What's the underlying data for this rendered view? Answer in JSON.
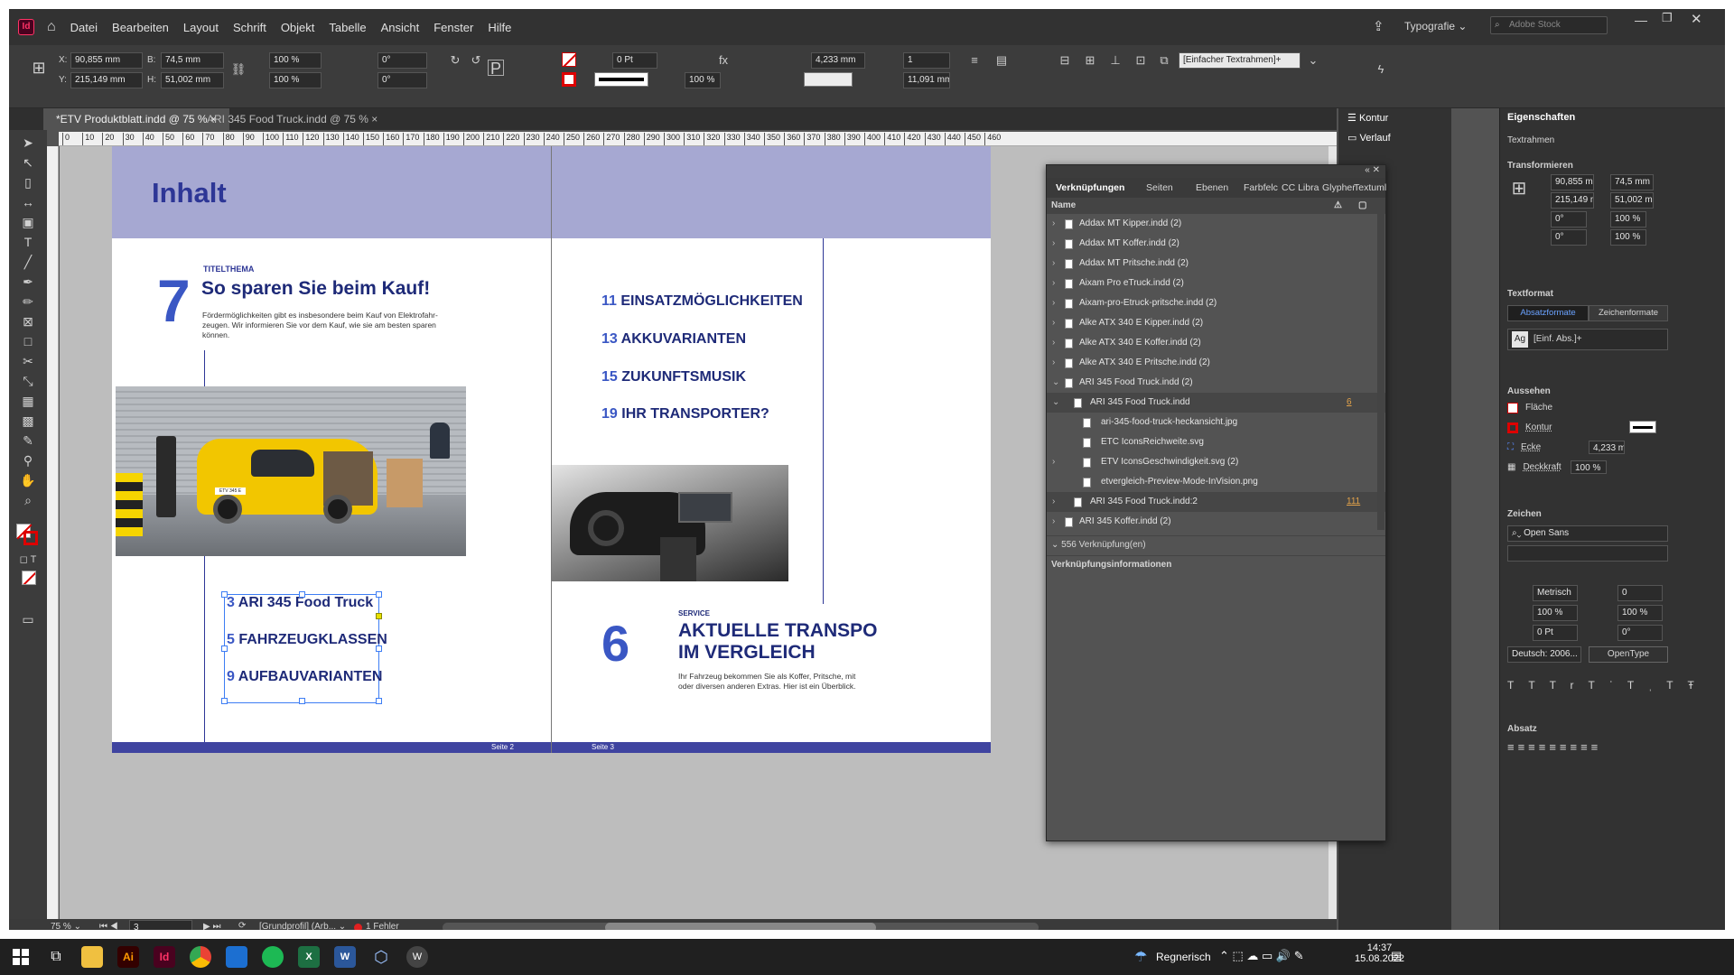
{
  "menu": {
    "items": [
      "Datei",
      "Bearbeiten",
      "Layout",
      "Schrift",
      "Objekt",
      "Tabelle",
      "Ansicht",
      "Fenster",
      "Hilfe"
    ],
    "workspace": "Typografie",
    "search_placeholder": "Adobe Stock",
    "app_badge": "Id"
  },
  "control": {
    "x": "90,855 mm",
    "y": "215,149 mm",
    "w": "74,5 mm",
    "h": "51,002 mm",
    "scale_x": "100 %",
    "scale_y": "100 %",
    "angle": "0°",
    "shear": "0°",
    "stroke": "0 Pt",
    "opacity": "100 %",
    "corner": "4,233 mm",
    "columns": "1",
    "gutter": "11,091 mm",
    "frame_style": "[Einfacher Textrahmen]+",
    "x_label": "X:",
    "y_label": "Y:",
    "b_label": "B:",
    "h_label": "H:"
  },
  "tabs": [
    {
      "label": "*ETV Produktblatt.indd @ 75 %"
    },
    {
      "label": "ARI 345 Food Truck.indd @ 75 %"
    }
  ],
  "ruler": {
    "ticks": [
      "0",
      "10",
      "20",
      "30",
      "40",
      "50",
      "60",
      "70",
      "80",
      "90",
      "100",
      "110",
      "120",
      "130",
      "140",
      "150",
      "160",
      "170",
      "180",
      "190",
      "200",
      "210",
      "220",
      "230",
      "240",
      "250",
      "260",
      "270",
      "280",
      "290",
      "300",
      "310",
      "320",
      "330",
      "340",
      "350",
      "360",
      "370",
      "380",
      "390",
      "400",
      "410",
      "420",
      "430",
      "440",
      "450",
      "460"
    ]
  },
  "page_left": {
    "header": "Inhalt",
    "kicker": "TITELTHEMA",
    "big_num": "7",
    "headline": "So sparen Sie beim Kauf!",
    "body": "Fördermöglichkeiten gibt es insbesondere beim Kauf von Elektrofahr-zeugen. Wir informieren Sie vor dem Kauf, wie sie am besten sparen können.",
    "toc": [
      {
        "num": "3",
        "text": "ARI 345 Food Truck"
      },
      {
        "num": "5",
        "text": "FAHRZEUGKLASSEN"
      },
      {
        "num": "9",
        "text": "AUFBAUVARIANTEN"
      }
    ],
    "footer": "Seite 2"
  },
  "page_right": {
    "toc": [
      {
        "num": "11",
        "text": "EINSATZMÖGLICHKEITEN"
      },
      {
        "num": "13",
        "text": "AKKUVARIANTEN"
      },
      {
        "num": "15",
        "text": "ZUKUNFTSMUSIK"
      },
      {
        "num": "19",
        "text": "IHR TRANSPORTER?"
      }
    ],
    "kicker": "SERVICE",
    "big_num": "6",
    "headline1": "AKTUELLE TRANSPO",
    "headline2": "IM VERGLEICH",
    "body1": "Ihr Fahrzeug bekommen Sie als  Koffer, Pritsche, mit",
    "body2": "oder diversen anderen Extras. Hier ist ein Überblick.",
    "footer": "Seite 3",
    "plate": "ETV 345 E"
  },
  "status": {
    "zoom": "75 %",
    "page": "3",
    "profile": "[Grundprofil] (Arb...",
    "errors": "1 Fehler"
  },
  "mini_panels": [
    {
      "label": "Kontur"
    },
    {
      "label": "Verlauf"
    }
  ],
  "links_panel": {
    "tabs": [
      "Verknüpfungen",
      "Seiten",
      "Ebenen",
      "Farbfelc",
      "CC Libra",
      "Glypher",
      "Textuml"
    ],
    "col_name": "Name",
    "rows": [
      {
        "name": "Addax MT Kipper.indd (2)",
        "indent": 0,
        "expand": "›",
        "page": ""
      },
      {
        "name": "Addax MT Koffer.indd (2)",
        "indent": 0,
        "expand": "›",
        "page": ""
      },
      {
        "name": "Addax MT Pritsche.indd (2)",
        "indent": 0,
        "expand": "›",
        "page": ""
      },
      {
        "name": "Aixam Pro eTruck.indd (2)",
        "indent": 0,
        "expand": "›",
        "page": ""
      },
      {
        "name": "Aixam-pro-Etruck-pritsche.indd (2)",
        "indent": 0,
        "expand": "›",
        "page": ""
      },
      {
        "name": "Alke ATX 340 E Kipper.indd (2)",
        "indent": 0,
        "expand": "›",
        "page": ""
      },
      {
        "name": "Alke ATX 340 E Koffer.indd (2)",
        "indent": 0,
        "expand": "›",
        "page": ""
      },
      {
        "name": "Alke ATX 340 E Pritsche.indd (2)",
        "indent": 0,
        "expand": "›",
        "page": ""
      },
      {
        "name": "ARI 345 Food Truck.indd (2)",
        "indent": 0,
        "expand": "⌄",
        "page": ""
      },
      {
        "name": "ARI 345 Food Truck.indd",
        "indent": 1,
        "expand": "⌄",
        "page": "6"
      },
      {
        "name": "ari-345-food-truck-heckansicht.jpg",
        "indent": 2,
        "expand": "",
        "page": ""
      },
      {
        "name": "ETC IconsReichweite.svg",
        "indent": 2,
        "expand": "",
        "page": ""
      },
      {
        "name": "ETV IconsGeschwindigkeit.svg (2)",
        "indent": 2,
        "expand": "›",
        "page": ""
      },
      {
        "name": "etvergleich-Preview-Mode-InVision.png",
        "indent": 2,
        "expand": "",
        "page": ""
      },
      {
        "name": "ARI 345 Food Truck.indd:2",
        "indent": 1,
        "expand": "›",
        "page": "111"
      },
      {
        "name": "ARI 345 Koffer.indd (2)",
        "indent": 0,
        "expand": "›",
        "page": ""
      }
    ],
    "count": "556 Verknüpfung(en)",
    "info_label": "Verknüpfungsinformationen"
  },
  "properties": {
    "tab": "Eigenschaften",
    "object_type": "Textrahmen",
    "transform_title": "Transformieren",
    "x": "90,855 mm",
    "y": "215,149 mm",
    "b": "74,5 mm",
    "h": "51,002 mm",
    "rot": "0°",
    "scale1": "100 %",
    "shear": "0°",
    "scale2": "100 %",
    "textformat_title": "Textformat",
    "tab_para": "Absatzformate",
    "tab_char": "Zeichenformate",
    "para_style": "[Einf. Abs.]+",
    "appearance_title": "Aussehen",
    "fill": "Fläche",
    "stroke": "Kontur",
    "corner": "Ecke",
    "corner_val": "4,233 mm",
    "opacity": "Deckkraft",
    "opacity_val": "100 %",
    "char_title": "Zeichen",
    "font": "Open Sans",
    "kerning": "Metrisch",
    "tracking": "0",
    "scale_v": "100 %",
    "scale_h": "100 %",
    "baseline": "0 Pt",
    "skew": "0°",
    "language": "Deutsch: 2006...",
    "opentype": "OpenType",
    "para_title": "Absatz"
  },
  "taskbar": {
    "weather": "Regnerisch",
    "time": "14:37",
    "date": "15.08.2022"
  },
  "colors": {
    "header_band": "#a6a8d2",
    "footer_band": "#3f44a0",
    "accent": "#3a57c4",
    "text_dark": "#1e2a78"
  }
}
